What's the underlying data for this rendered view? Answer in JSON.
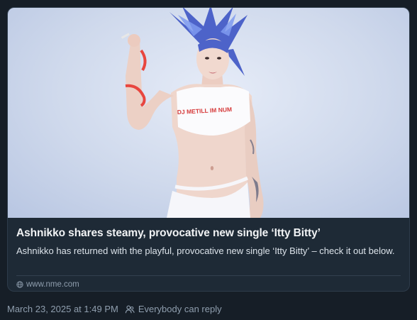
{
  "card": {
    "title": "Ashnikko shares steamy, provocative new single ‘Itty Bitty’",
    "description": "Ashnikko has returned with the playful, provocative new single ‘Itty Bitty’ – check it out below.",
    "domain": "www.nme.com",
    "image_top_text": "DJ METILL IM NUM"
  },
  "post_meta": {
    "timestamp": "March 23, 2025 at 1:49 PM",
    "reply_setting": "Everybody can reply"
  },
  "colors": {
    "background": "#161e27",
    "card": "#1e2a36",
    "text_primary": "#f1f3f5",
    "text_muted": "#8f9eae"
  },
  "icons": {
    "link": "globe-icon",
    "reply": "people-icon"
  }
}
